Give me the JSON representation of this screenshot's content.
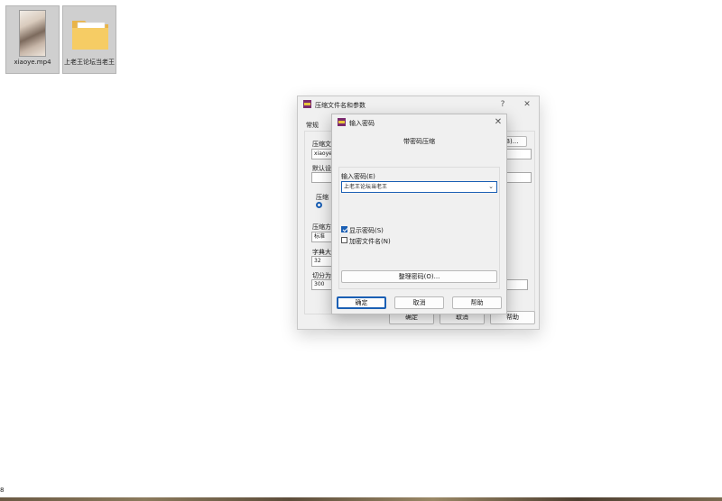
{
  "desktop": {
    "icons": [
      {
        "label": "xiaoye.mp4",
        "icon": "video-thumbnail-icon"
      },
      {
        "label": "上老王论坛当老王",
        "icon": "folder-icon"
      }
    ]
  },
  "main_dialog": {
    "title": "压缩文件名和参数",
    "help_glyph": "?",
    "close_glyph": "✕",
    "tab_general": "常规",
    "archive_name_label": "压缩文",
    "archive_name_value": "xiaoye",
    "browse_suffix": "(B)...",
    "default_profile_label": "默认设",
    "format_group_label": "压缩",
    "compress_method_label": "压缩方",
    "compress_method_value": "标准",
    "dict_size_label": "字典大",
    "dict_size_value": "32",
    "split_label": "切分为",
    "split_value": "300",
    "ok_label": "确定",
    "cancel_label": "取消",
    "help_label": "帮助"
  },
  "password_dialog": {
    "title": "输入密码",
    "close_glyph": "✕",
    "header": "带密码压缩",
    "input_label": "输入密码(E)",
    "input_value": "上老王论坛当老王",
    "show_password_label": "显示密码(S)",
    "show_password_checked": true,
    "encrypt_names_label": "加密文件名(N)",
    "encrypt_names_checked": false,
    "organize_label": "整理密码(O)...",
    "ok_label": "确定",
    "cancel_label": "取消",
    "help_label": "帮助"
  },
  "edge_char": "8",
  "colors": {
    "accent": "#1a5fb4",
    "dialog_bg": "#f0f0f0",
    "folder": "#f2c25c"
  }
}
